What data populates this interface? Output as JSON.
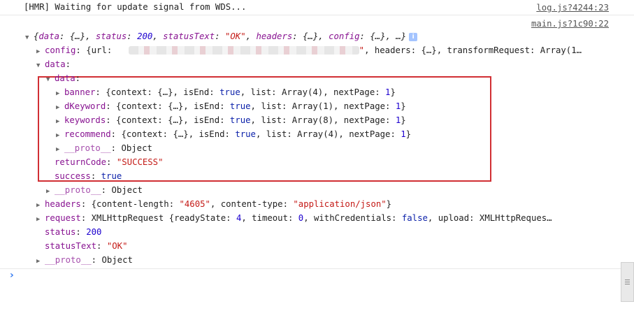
{
  "hmr": {
    "text": "[HMR] Waiting for update signal from WDS...",
    "source": "log.js?4244:23"
  },
  "log": {
    "source": "main.js?1c90:22",
    "summary": {
      "open": "{",
      "k_data": "data",
      "v_data": "{…}",
      "k_status": "status",
      "v_status": "200",
      "k_statusText": "statusText",
      "v_statusText": "\"OK\"",
      "k_headers": "headers",
      "v_headers": "{…}",
      "k_config": "config",
      "v_config": "{…}",
      "tail": "…}",
      "info_icon": "info-icon"
    },
    "config": {
      "key": "config",
      "pre": "{url: ",
      "url_end": "\"",
      "rest": ", headers: {…}, transformRequest: Array(1…"
    },
    "data_key": "data",
    "inner": {
      "data_key": "data",
      "banner": {
        "key": "banner",
        "a": "{context: {…}, isEnd: ",
        "isEnd": "true",
        "b": ", list: Array(4), nextPage: ",
        "nextPage": "1",
        "c": "}"
      },
      "dKeyword": {
        "key": "dKeyword",
        "a": "{context: {…}, isEnd: ",
        "isEnd": "true",
        "b": ", list: Array(1), nextPage: ",
        "nextPage": "1",
        "c": "}"
      },
      "keywords": {
        "key": "keywords",
        "a": "{context: {…}, isEnd: ",
        "isEnd": "true",
        "b": ", list: Array(8), nextPage: ",
        "nextPage": "1",
        "c": "}"
      },
      "recommend": {
        "key": "recommend",
        "a": "{context: {…}, isEnd: ",
        "isEnd": "true",
        "b": ", list: Array(4), nextPage: ",
        "nextPage": "1",
        "c": "}"
      },
      "proto": {
        "key": "__proto__",
        "value": "Object"
      },
      "returnCode": {
        "key": "returnCode",
        "value": "\"SUCCESS\""
      },
      "success": {
        "key": "success",
        "value": "true"
      }
    },
    "data_proto": {
      "key": "__proto__",
      "value": "Object"
    },
    "headers": {
      "key": "headers",
      "a": "{content-length: ",
      "len": "\"4605\"",
      "b": ", content-type: ",
      "type": "\"application/json\"",
      "c": "}"
    },
    "request": {
      "key": "request",
      "a": "XMLHttpRequest {readyState: ",
      "rs": "4",
      "b": ", timeout: ",
      "to": "0",
      "c": ", withCredentials: ",
      "wc": "false",
      "d": ", upload: XMLHttpReques…"
    },
    "status": {
      "key": "status",
      "value": "200"
    },
    "statusText": {
      "key": "statusText",
      "value": "\"OK\""
    },
    "proto": {
      "key": "__proto__",
      "value": "Object"
    }
  },
  "colors": {
    "key": "#881391",
    "string": "#c41a16",
    "number": "#1c00cf",
    "keyword": "#0d22aa",
    "highlight_border": "#d12f34",
    "prompt": "#367cf1"
  }
}
